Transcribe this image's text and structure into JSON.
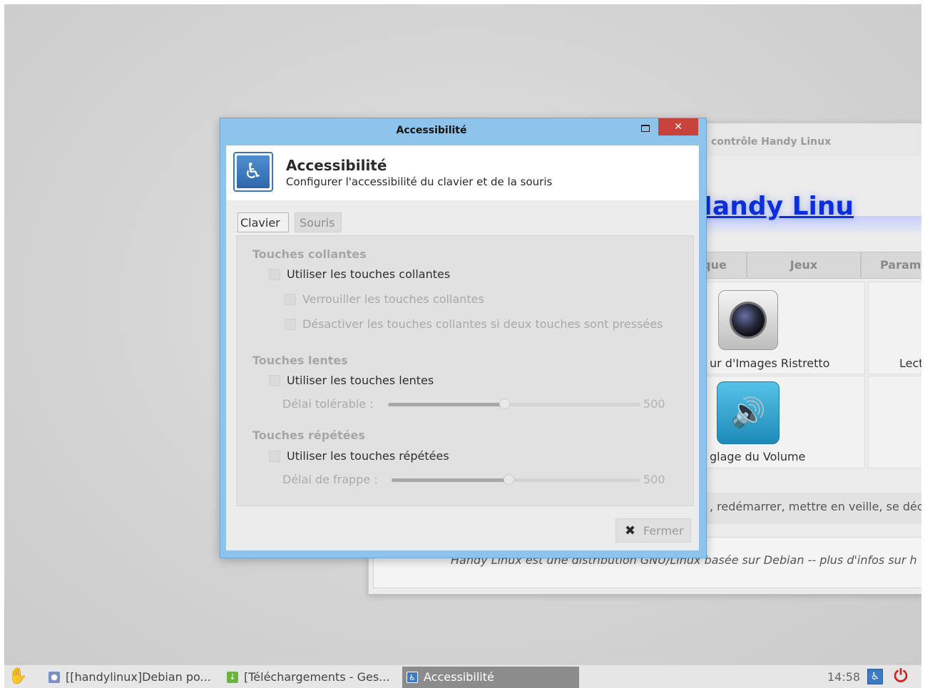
{
  "background_window": {
    "title": "contrôle Handy Linux",
    "heading": "rôle Handy Linu",
    "tabs": [
      "que",
      "Jeux",
      "Param"
    ],
    "items": [
      "ur d'Images Ristretto",
      "Lecte",
      "glage du Volume"
    ],
    "shutdown_text": ", redémarrer, mettre en veille, se déc",
    "footer_text": "Handy Linux est une distribution GNU/Linux basée sur Debian -- plus d'infos sur h"
  },
  "dialog": {
    "window_title": "Accessibilité",
    "close_label": "✕",
    "header": {
      "title": "Accessibilité",
      "subtitle": "Configurer l'accessibilité du clavier et de la souris"
    },
    "tabs": [
      {
        "label": "Clavier",
        "active": true
      },
      {
        "label": "Souris",
        "active": false
      }
    ],
    "sections": {
      "sticky": {
        "title": "Touches collantes",
        "use": "Utiliser les touches collantes",
        "lock": "Verrouiller les touches collantes",
        "disable": "Désactiver les touches collantes si deux touches sont pressées"
      },
      "slow": {
        "title": "Touches lentes",
        "use": "Utiliser les touches lentes",
        "delay_label": "Délai tolérable :",
        "delay_value": "500",
        "delay_fraction": 0.46
      },
      "repeat": {
        "title": "Touches répétées",
        "use": "Utiliser les touches répétées",
        "delay_label": "Délai de frappe :",
        "delay_value": "500",
        "delay_fraction": 0.47
      }
    },
    "close_button": "Fermer"
  },
  "taskbar": {
    "tasks": [
      {
        "label": "[[handylinux]Debian po...",
        "icon": "browser-icon"
      },
      {
        "label": "[Téléchargements - Ges...",
        "icon": "download-icon"
      },
      {
        "label": "Accessibilité",
        "icon": "accessibility-icon",
        "active": true
      }
    ],
    "clock": "14:58"
  },
  "colors": {
    "dialog_frame": "#8ec4ec",
    "close_button": "#c9433d",
    "link_heading": "#0d2fd9",
    "power_icon": "#d12222"
  }
}
